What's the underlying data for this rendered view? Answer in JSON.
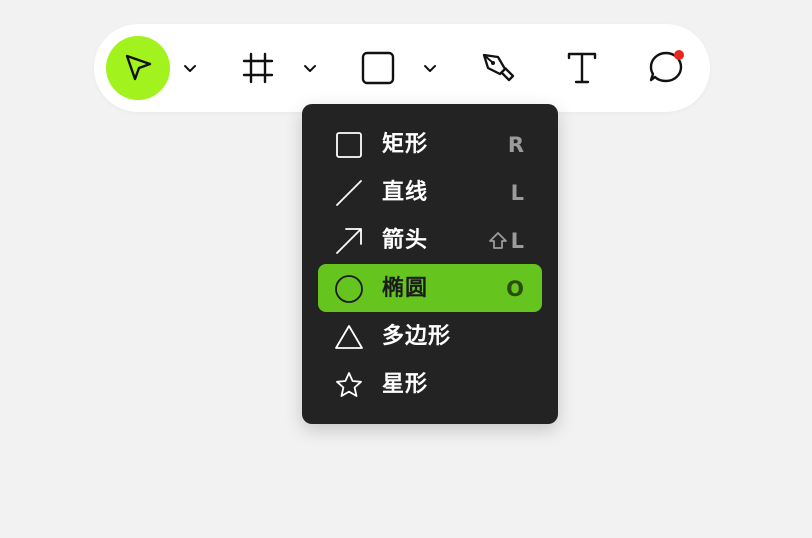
{
  "colors": {
    "background": "#f2f2f3",
    "toolbar": "#ffffff",
    "active_tool": "#a2f21d",
    "menu_bg": "#232323",
    "menu_selected": "#66c41e",
    "notification_dot": "#e8261c"
  },
  "toolbar": {
    "tools": [
      {
        "icon": "cursor-arrow-icon",
        "active": true,
        "has_dropdown": true
      },
      {
        "icon": "frame-hash-icon",
        "active": false,
        "has_dropdown": true
      },
      {
        "icon": "rectangle-icon",
        "active": false,
        "has_dropdown": true
      },
      {
        "icon": "pen-icon",
        "active": false,
        "has_dropdown": false
      },
      {
        "icon": "text-icon",
        "active": false,
        "has_dropdown": false
      },
      {
        "icon": "comment-icon",
        "active": false,
        "has_dropdown": false,
        "notification": true
      }
    ]
  },
  "shape_menu": {
    "items": [
      {
        "icon": "square-icon",
        "label": "矩形",
        "shortcut": "R",
        "selected": false
      },
      {
        "icon": "line-icon",
        "label": "直线",
        "shortcut": "L",
        "selected": false
      },
      {
        "icon": "arrow-icon",
        "label": "箭头",
        "shortcut": "L",
        "shortcut_modifier": "shift-icon",
        "selected": false
      },
      {
        "icon": "circle-icon",
        "label": "椭圆",
        "shortcut": "O",
        "selected": true
      },
      {
        "icon": "triangle-icon",
        "label": "多边形",
        "shortcut": "",
        "selected": false
      },
      {
        "icon": "star-icon",
        "label": "星形",
        "shortcut": "",
        "selected": false
      }
    ]
  }
}
